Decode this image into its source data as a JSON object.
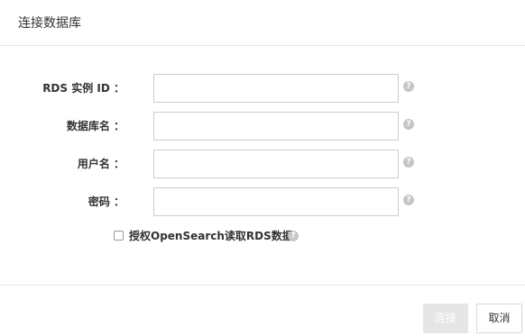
{
  "dialog": {
    "title": "连接数据库",
    "fields": [
      {
        "label": "RDS 实例 ID ：",
        "value": "",
        "help_icon": "question-circle-icon"
      },
      {
        "label": "数据库名 ：",
        "value": "",
        "help_icon": "question-circle-icon"
      },
      {
        "label": "用户名 ：",
        "value": "",
        "help_icon": "question-circle-icon"
      },
      {
        "label": "密码 ：",
        "value": "",
        "help_icon": "question-circle-icon"
      }
    ],
    "authorize": {
      "label": "授权OpenSearch读取RDS数据",
      "checked": false
    },
    "buttons": {
      "connect": "连接",
      "cancel": "取消"
    },
    "colors": {
      "connect_disabled_bg": "#e6e6e6",
      "border": "#cccccc",
      "help_icon": "#c6c6c6"
    }
  }
}
